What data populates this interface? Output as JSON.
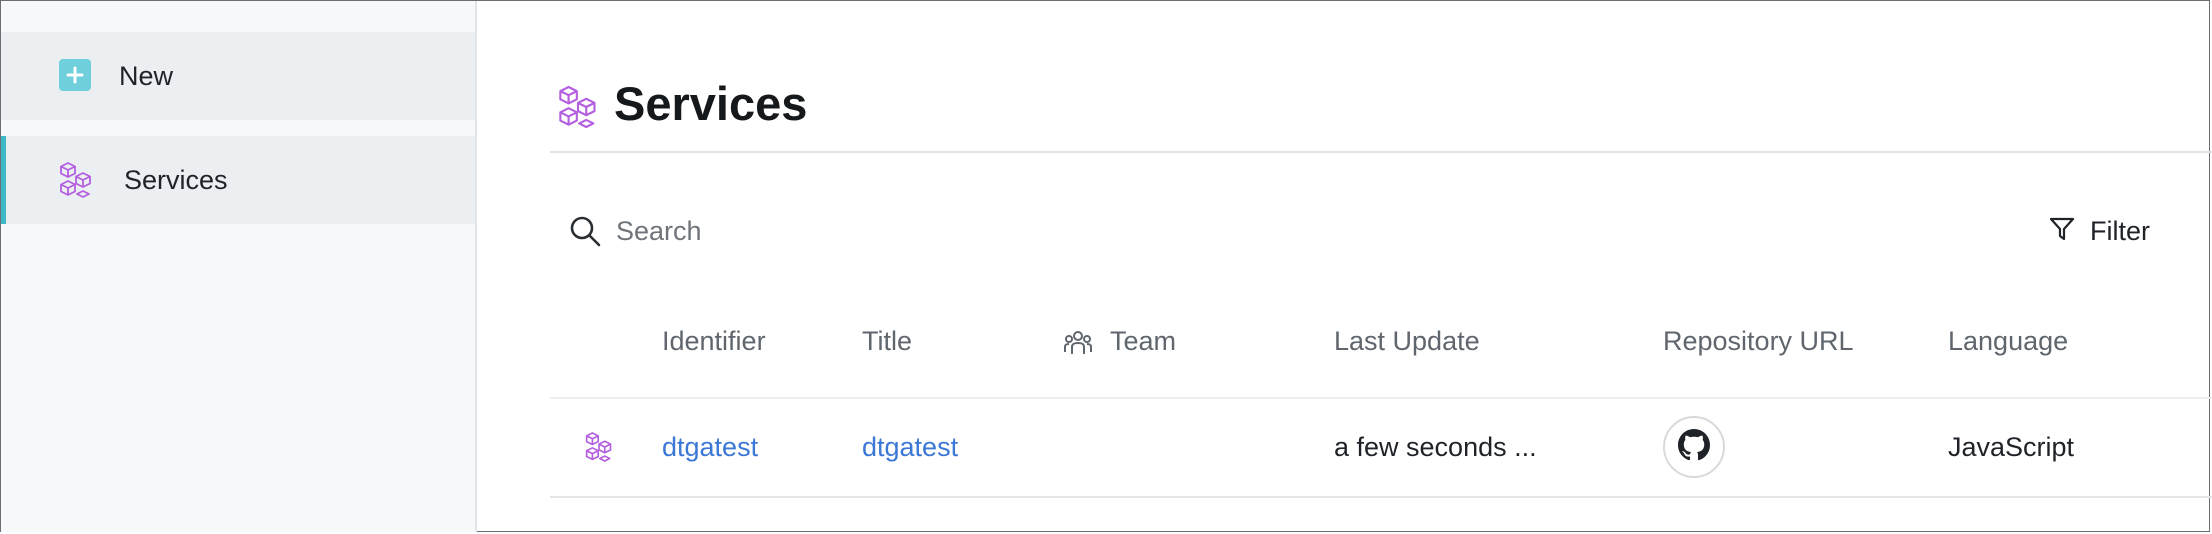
{
  "sidebar": {
    "items": [
      {
        "label": "New",
        "icon": "plus-square-icon"
      },
      {
        "label": "Services",
        "icon": "cubes-icon",
        "active": true
      }
    ]
  },
  "page": {
    "title": "Services",
    "title_icon": "cubes-icon"
  },
  "search": {
    "placeholder": "Search"
  },
  "filter": {
    "label": "Filter"
  },
  "table": {
    "columns": [
      "Identifier",
      "Title",
      "Team",
      "Last Update",
      "Repository URL",
      "Language"
    ],
    "rows": [
      {
        "identifier": "dtgatest",
        "title": "dtgatest",
        "team": "",
        "last_update": "a few seconds ...",
        "repository_icon": "github-icon",
        "language": "JavaScript"
      }
    ]
  },
  "colors": {
    "accent": "#3fb8c5",
    "link": "#3b77d6",
    "cube_purple": "#b45ee0",
    "new_icon_bg": "#6fcfda"
  }
}
